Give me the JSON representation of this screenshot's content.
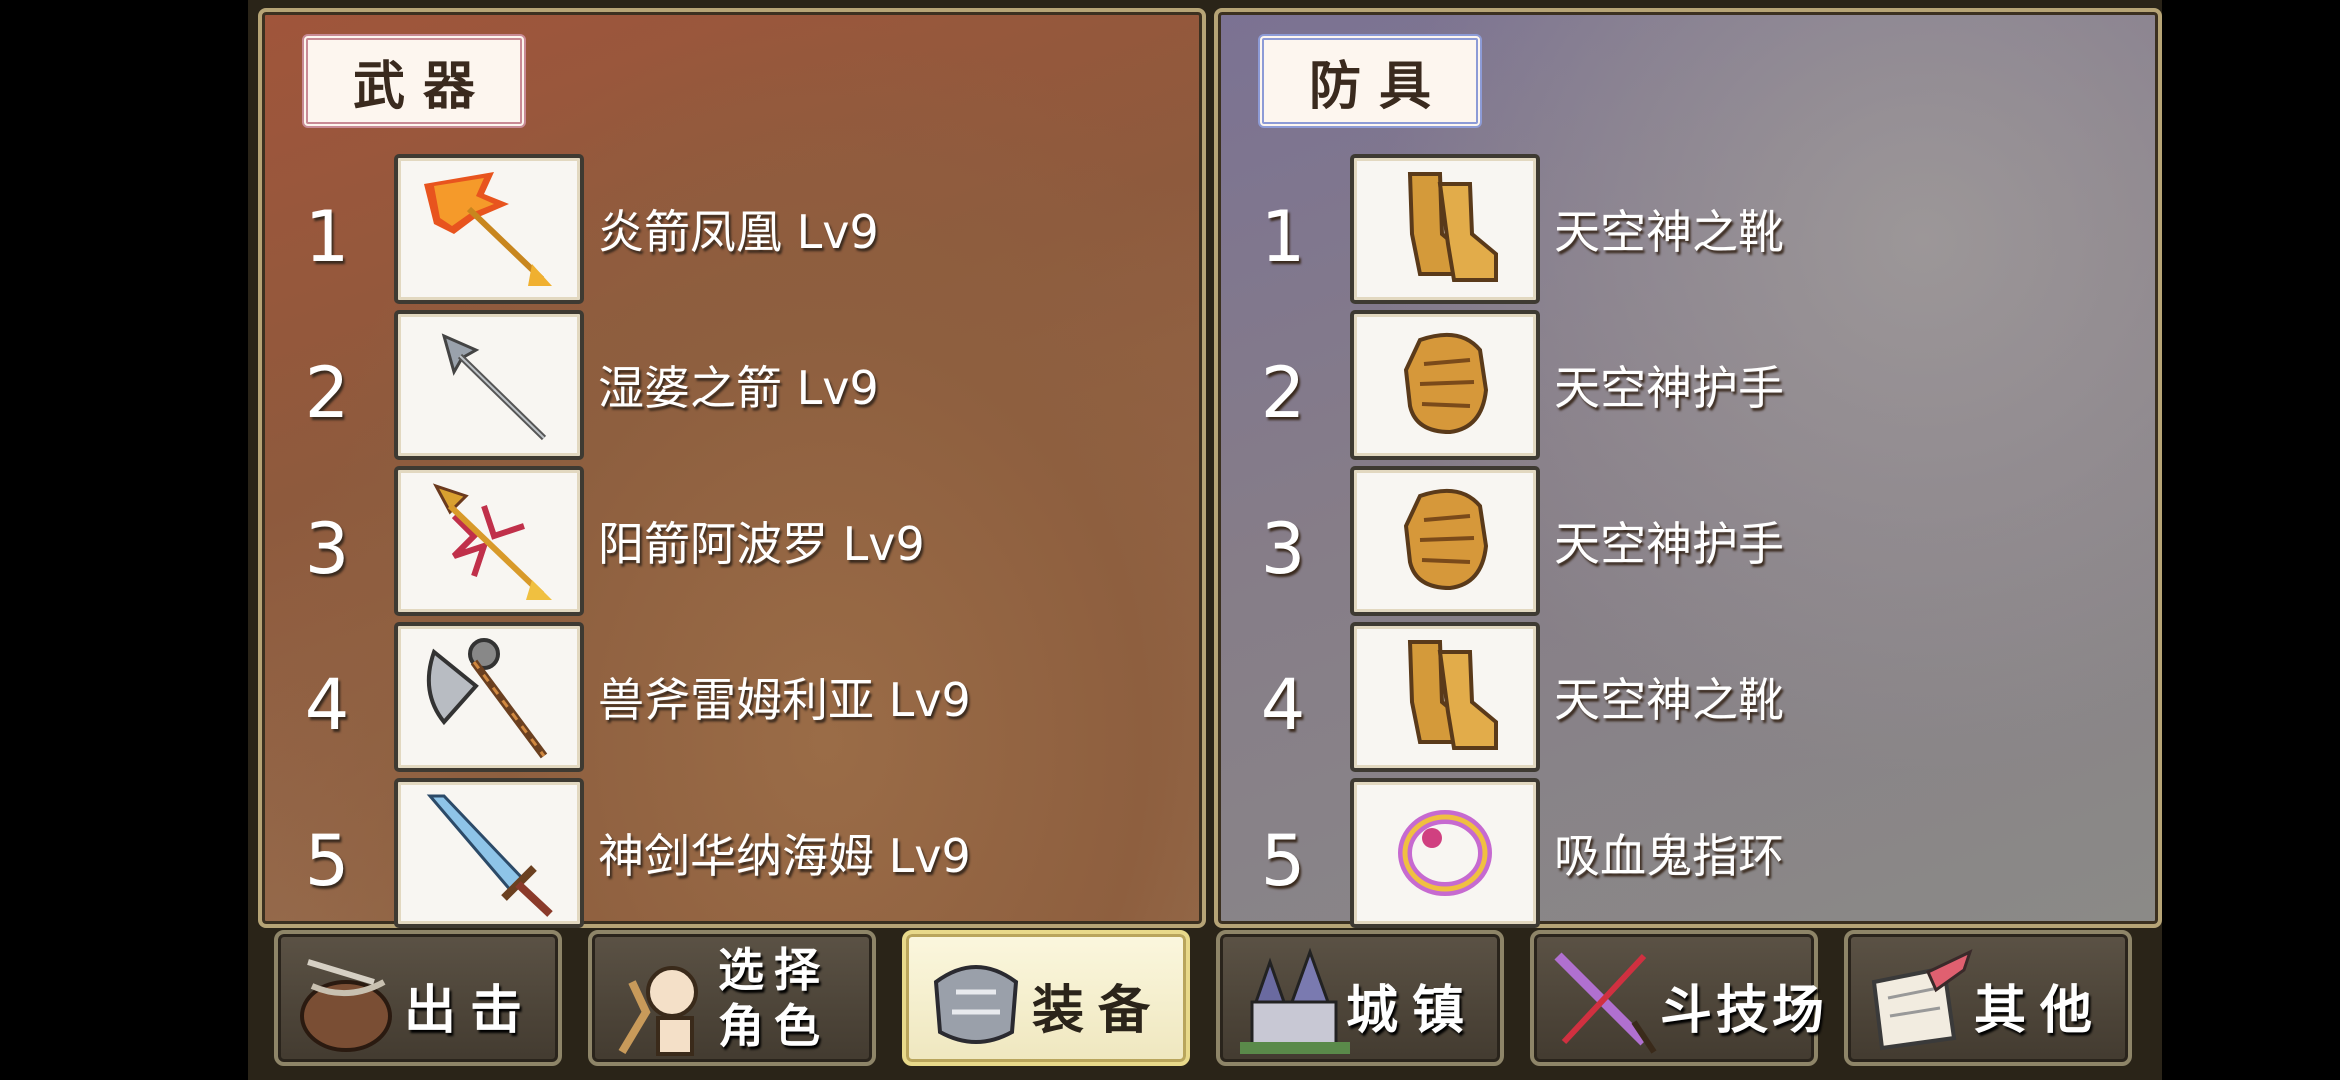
{
  "weapons": {
    "title": "武器",
    "items": [
      {
        "num": "1",
        "name": "炎箭凤凰 Lv9",
        "icon": "flame-arrow-icon"
      },
      {
        "num": "2",
        "name": "湿婆之箭 Lv9",
        "icon": "silver-arrow-icon"
      },
      {
        "num": "3",
        "name": "阳箭阿波罗 Lv9",
        "icon": "sun-arrow-icon"
      },
      {
        "num": "4",
        "name": "兽斧雷姆利亚 Lv9",
        "icon": "battle-axe-icon"
      },
      {
        "num": "5",
        "name": "神剑华纳海姆 Lv9",
        "icon": "sword-icon"
      }
    ]
  },
  "armor": {
    "title": "防具",
    "items": [
      {
        "num": "1",
        "name": "天空神之靴",
        "icon": "boots-icon"
      },
      {
        "num": "2",
        "name": "天空神护手",
        "icon": "gauntlet-icon"
      },
      {
        "num": "3",
        "name": "天空神护手",
        "icon": "gauntlet-icon"
      },
      {
        "num": "4",
        "name": "天空神之靴",
        "icon": "boots-icon"
      },
      {
        "num": "5",
        "name": "吸血鬼指环",
        "icon": "ring-icon"
      }
    ]
  },
  "nav": {
    "sortie": "出击",
    "select_line1": "选择",
    "select_line2": "角色",
    "equip": "装备",
    "town": "城镇",
    "arena": "斗技场",
    "other": "其他",
    "active": "equip"
  },
  "colors": {
    "weapon_panel": "#8e5a3d",
    "armor_panel": "#867d88",
    "active_button": "#fbf7de"
  }
}
